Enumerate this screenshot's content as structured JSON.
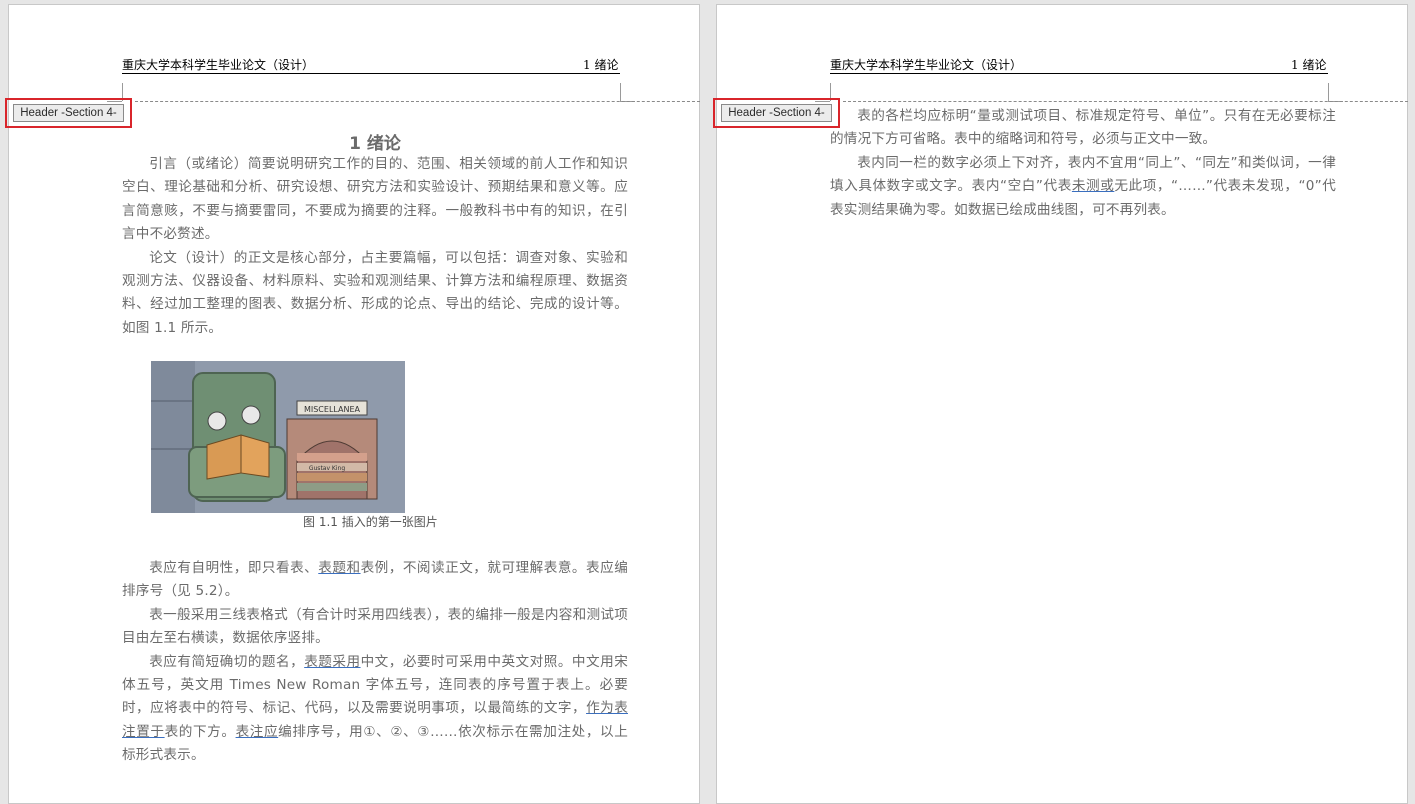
{
  "header": {
    "title": "重庆大学本科学生毕业论文（设计）",
    "chapter": "1 绪论",
    "tag_label": "Header -Section 4-"
  },
  "page1": {
    "heading": "1 绪论",
    "paragraphs": [
      "引言（或绪论）简要说明研究工作的目的、范围、相关领域的前人工作和知识空白、理论基础和分析、研究设想、研究方法和实验设计、预期结果和意义等。应言简意赅，不要与摘要雷同，不要成为摘要的注释。一般教科书中有的知识，在引言中不必赘述。",
      "论文（设计）的正文是核心部分，占主要篇幅，可以包括：调查对象、实验和观测方法、仪器设备、材料原料、实验和观测结果、计算方法和编程原理、数据资料、经过加工整理的图表、数据分析、形成的论点、导出的结论、完成的设计等。如图 1.1 所示。"
    ],
    "figure_caption": "图 1.1 插入的第一张图片",
    "figure_sign_1": "MISCELLANEA",
    "figure_sign_2": "Gustav King",
    "para3_a": "表应有自明性，即只看表、",
    "para3_u": "表题和",
    "para3_b": "表例，不阅读正文，就可理解表意。表应编排序号（见 5.2）。",
    "para4": "表一般采用三线表格式（有合计时采用四线表），表的编排一般是内容和测试项目由左至右横读，数据依序竖排。",
    "para5_a": "表应有简短确切的题名，",
    "para5_u1": "表题采用",
    "para5_b": "中文，必要时可采用中英文对照。中文用宋体五号，英文用 Times New Roman 字体五号，连同表的序号置于表上。必要时，应将表中的符号、标记、代码，以及需要说明事项，以最简练的文字，",
    "para5_u2": "作为表注置于",
    "para5_c": "表的下方。",
    "para5_u3": "表注应",
    "para5_d": "编排序号，用①、②、③……依次标示在需加注处，以上标形式表示。"
  },
  "page2": {
    "para1": "表的各栏均应标明“量或测试项目、标准规定符号、单位”。只有在无必要标注的情况下方可省略。表中的缩略词和符号，必须与正文中一致。",
    "para2_a": "表内同一栏的数字必须上下对齐，表内不宜用“同上”、“同左”和类似词，一律填入具体数字或文字。表内“空白”代表",
    "para2_u": "未测或",
    "para2_b": "无此项，“……”代表未发现，“0”代表实测结果确为零。如数据已绘成曲线图，可不再列表。"
  },
  "colors": {
    "highlight_border": "#d9252b",
    "underline": "#3a6fc0",
    "page_bg": "#ffffff",
    "workspace_bg": "#e6e6e6"
  }
}
